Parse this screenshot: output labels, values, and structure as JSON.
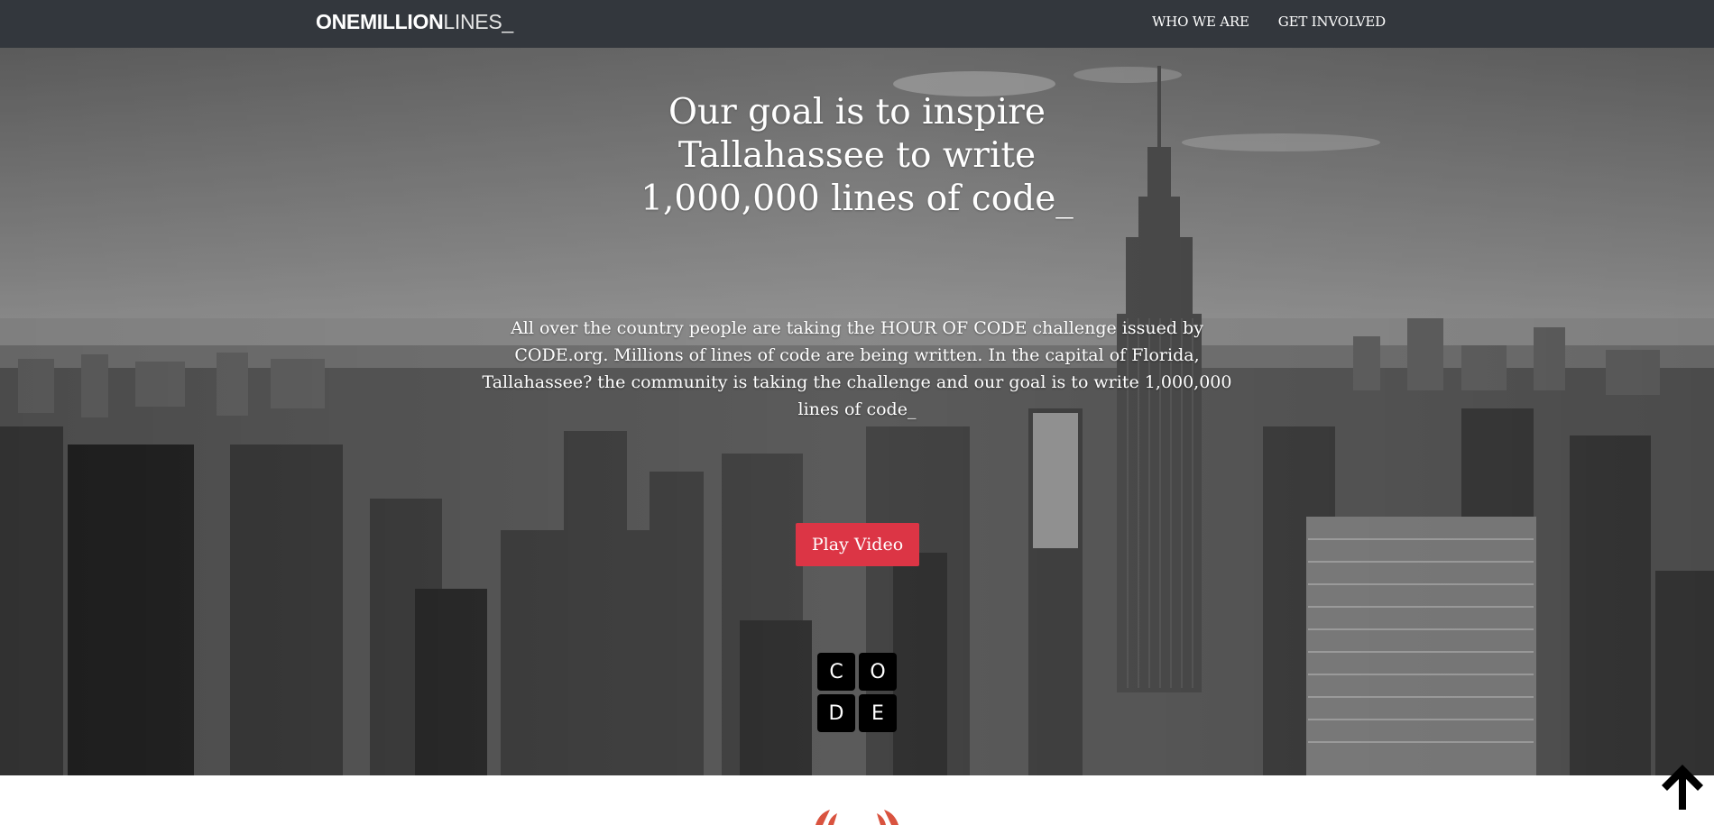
{
  "nav": {
    "brand_bold": "ONEMILLION",
    "brand_light": "LINES_",
    "links": [
      {
        "label": "WHO WE ARE"
      },
      {
        "label": "GET INVOLVED"
      }
    ]
  },
  "hero": {
    "title_lines": [
      "Our goal is to inspire",
      "Tallahassee to write",
      "1,000,000 lines of code_"
    ],
    "description": "All over the country people are taking the HOUR OF CODE challenge issued by CODE.org. Millions of lines of code are being written. In the capital of Florida, Tallahassee? the community is taking the challenge and our goal is to write 1,000,000 lines of code_",
    "play_button": "Play Video",
    "code_logo": [
      "C",
      "O",
      "D",
      "E"
    ]
  },
  "icons": {
    "back_to_top": "arrow-up-icon",
    "laurel": "laurel-wreath-icon",
    "logo": "code-org-logo"
  },
  "colors": {
    "nav_bg": "#33373d",
    "accent": "#dc3545",
    "laurel": "#d9533f"
  }
}
